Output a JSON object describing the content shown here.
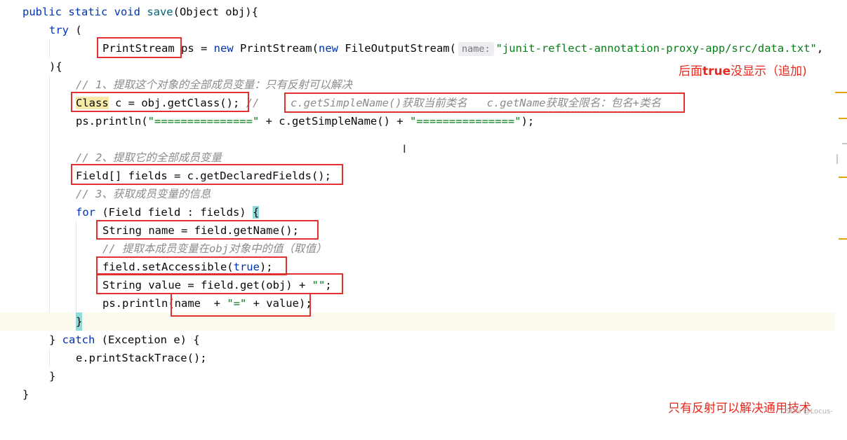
{
  "code": {
    "l1": {
      "kw": "public static void ",
      "fn": "save",
      "rest": "(Object obj){"
    },
    "l2": {
      "kw": "try",
      "rest": " ("
    },
    "l3": {
      "t1": "PrintStream",
      "t2": " ps = ",
      "kw1": "new",
      "t3": " PrintStream(",
      "kw2": "new",
      "t4": " FileOutputStream(",
      "hint": "name:",
      "str": "\"junit-reflect-annotation-proxy-app/src/data.txt\"",
      "t5": ","
    },
    "l4": {
      "text": "){"
    },
    "l5": {
      "cm": "// 1、提取这个对象的全部成员变量：只有反射可以解决"
    },
    "l6": {
      "t1": "Class",
      "t2": " c = obj.getClass(); ",
      "cm1": "// ",
      "cm2": "c.getSimpleName()获取当前类名   c.getName获取全限名：包名+类名"
    },
    "l7": {
      "t1": "ps.println(",
      "s1": "\"===============\"",
      "t2": " + c.getSimpleName() + ",
      "s2": "\"===============\"",
      "t3": ");"
    },
    "l9": {
      "cm": "// 2、提取它的全部成员变量"
    },
    "l10": {
      "text": "Field[] fields = c.getDeclaredFields();"
    },
    "l11": {
      "cm": "// 3、获取成员变量的信息"
    },
    "l12": {
      "kw": "for",
      "t1": " (Field field : fields) ",
      "brace": "{"
    },
    "l13": {
      "text": "String name = field.getName();"
    },
    "l14": {
      "cm": "// 提取本成员变量在obj对象中的值（取值）"
    },
    "l15": {
      "t1": "field.setAccessible(",
      "kw": "true",
      "t2": ");"
    },
    "l16": {
      "t1": "String value = field.get(obj) + ",
      "str": "\"\"",
      "t2": ";"
    },
    "l17": {
      "t1": "ps.println(name  + ",
      "str": "\"=\"",
      "t2": " + value);"
    },
    "l18": {
      "brace": "}"
    },
    "l19": {
      "t1": "} ",
      "kw": "catch",
      "t2": " (Exception e) {"
    },
    "l20": {
      "text": "e.printStackTrace();"
    },
    "l21": {
      "text": "}"
    },
    "l22": {
      "text": "}"
    }
  },
  "annotations": {
    "top_pre": "后面",
    "top_bold": "true",
    "top_post": "没显示（追加)",
    "bottom": "只有反射可以解决通用技术"
  },
  "watermark": "CSDN @Locus-",
  "colors": {
    "box": "#e03030",
    "annotation": "#e8281e",
    "keyword": "#0033b3",
    "string": "#067d17",
    "comment": "#8c8c8c"
  }
}
